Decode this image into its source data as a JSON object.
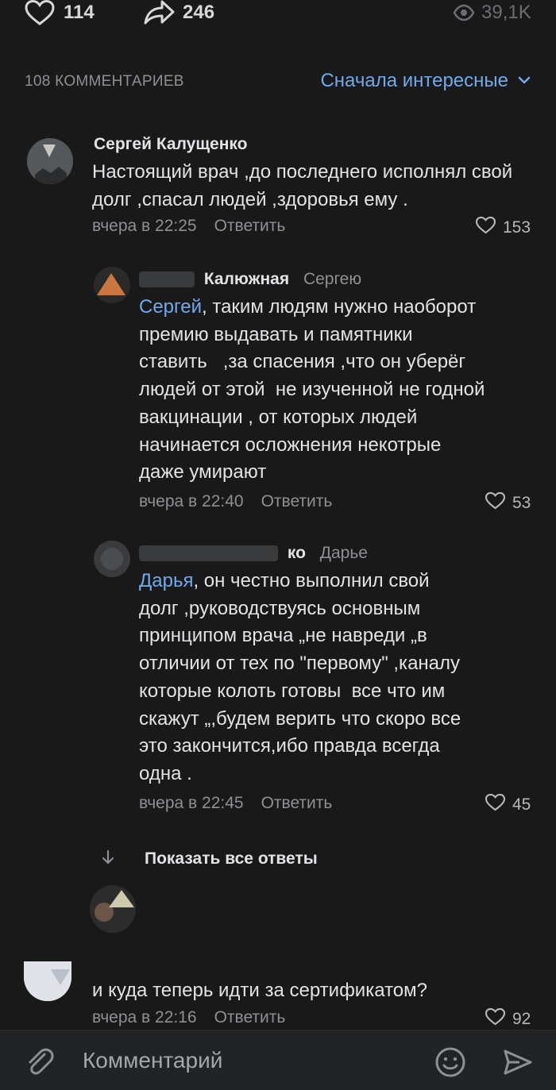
{
  "stats": {
    "likes": "114",
    "shares": "246",
    "views": "39,1K"
  },
  "header": {
    "count_label": "108 КОММЕНТАРИЕВ",
    "sort_label": "Сначала интересные"
  },
  "comments": [
    {
      "author": "Сергей Калущенко",
      "reply_to": "",
      "text": "Настоящий врач ,до последнего исполнял свой долг ,спасал людей ,здоровья ему .",
      "time": "вчера в 22:25",
      "reply_label": "Ответить",
      "likes": "153"
    },
    {
      "author": "Калюжная",
      "reply_to": "Сергею",
      "mention": "Сергей",
      "text": ", таким людям нужно наоборот\nпремию выдавать и памятники\nставить   ,за спасения ,что он уберёг\nлюдей от этой  не изученной не годной\nвакцинации , от которых людей\nначинается осложнения некотрые\nдаже умирают",
      "time": "вчера в 22:40",
      "reply_label": "Ответить",
      "likes": "53"
    },
    {
      "author": "ко",
      "reply_to": "Дарье",
      "mention": "Дарья",
      "text": ", он честно выполнил свой\nдолг ,руководствуясь основным\nпринципом врача „не навреди „в\nотличии от тех по \"первому\" ,каналу\nкоторые колоть готовы  все что им\nскажут „,будем верить что скоро все\nэто закончится,ибо правда всегда\nодна .",
      "time": "вчера в 22:45",
      "reply_label": "Ответить",
      "likes": "45"
    },
    {
      "author": "",
      "reply_to": "",
      "text": "и куда теперь идти за сертификатом?",
      "time": "вчера в 22:16",
      "reply_label": "Ответить",
      "likes": "92"
    }
  ],
  "show_all_label": "Показать все ответы",
  "composer": {
    "placeholder": "Комментарий"
  },
  "colors": {
    "background": "#191919",
    "accent": "#71aaeb",
    "secondary_text": "#8d9095"
  }
}
